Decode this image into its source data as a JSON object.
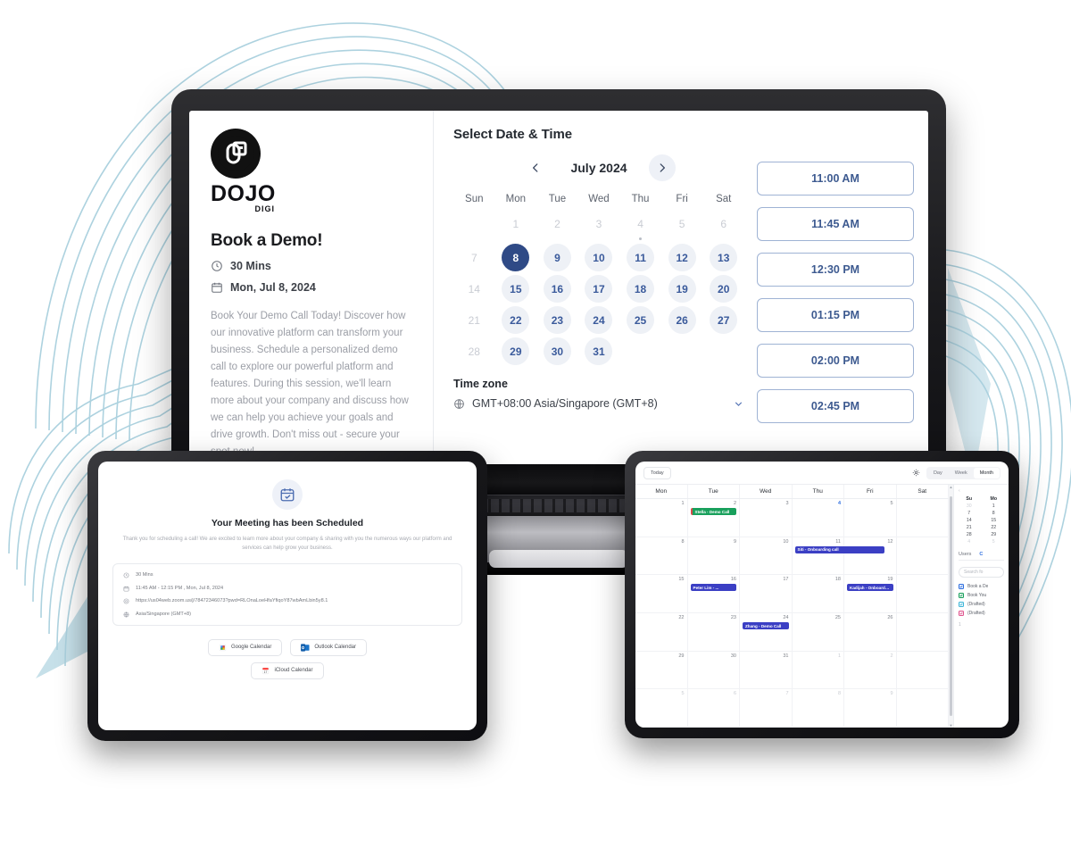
{
  "colors": {
    "swirl": "#a9d0de",
    "accent": "#2f4a86",
    "slot_border": "#9fb3d4",
    "slot_text": "#3d5a90",
    "event_blue": "#3b3fc4",
    "event_green": "#19a05c",
    "device_frame": "#17171a"
  },
  "booking_panel": {
    "logo_word": "DOJO",
    "logo_sub": "DIGI",
    "title": "Book a Demo!",
    "duration": "30 Mins",
    "date": "Mon, Jul 8, 2024",
    "description": "Book Your Demo Call Today!\nDiscover how our innovative platform can transform your business. Schedule a personalized demo call to explore our powerful platform and features. During this session, we'll learn more about your company and discuss how we can help you achieve your goals and drive growth.\nDon't miss out - secure your spot now!"
  },
  "select_panel": {
    "title": "Select Date & Time",
    "month_label": "July 2024",
    "prev_label": "‹",
    "next_label": "›",
    "dow": [
      "Sun",
      "Mon",
      "Tue",
      "Wed",
      "Thu",
      "Fri",
      "Sat"
    ],
    "weeks": [
      [
        {
          "n": "",
          "t": "blank"
        },
        {
          "n": "1",
          "t": "muted"
        },
        {
          "n": "2",
          "t": "muted"
        },
        {
          "n": "3",
          "t": "muted"
        },
        {
          "n": "4",
          "t": "muted",
          "dot": true
        },
        {
          "n": "5",
          "t": "muted"
        },
        {
          "n": "6",
          "t": "muted"
        }
      ],
      [
        {
          "n": "7",
          "t": "muted"
        },
        {
          "n": "8",
          "t": "sel"
        },
        {
          "n": "9",
          "t": "avail"
        },
        {
          "n": "10",
          "t": "avail"
        },
        {
          "n": "11",
          "t": "avail"
        },
        {
          "n": "12",
          "t": "avail"
        },
        {
          "n": "13",
          "t": "avail"
        }
      ],
      [
        {
          "n": "14",
          "t": "muted"
        },
        {
          "n": "15",
          "t": "avail"
        },
        {
          "n": "16",
          "t": "avail"
        },
        {
          "n": "17",
          "t": "avail"
        },
        {
          "n": "18",
          "t": "avail"
        },
        {
          "n": "19",
          "t": "avail"
        },
        {
          "n": "20",
          "t": "avail"
        }
      ],
      [
        {
          "n": "21",
          "t": "muted"
        },
        {
          "n": "22",
          "t": "avail"
        },
        {
          "n": "23",
          "t": "avail"
        },
        {
          "n": "24",
          "t": "avail"
        },
        {
          "n": "25",
          "t": "avail"
        },
        {
          "n": "26",
          "t": "avail"
        },
        {
          "n": "27",
          "t": "avail"
        }
      ],
      [
        {
          "n": "28",
          "t": "muted"
        },
        {
          "n": "29",
          "t": "avail"
        },
        {
          "n": "30",
          "t": "avail"
        },
        {
          "n": "31",
          "t": "avail"
        },
        {
          "n": "",
          "t": "blank"
        },
        {
          "n": "",
          "t": "blank"
        },
        {
          "n": "",
          "t": "blank"
        }
      ]
    ],
    "timezone_label": "Time zone",
    "timezone_value": "GMT+08:00 Asia/Singapore (GMT+8)",
    "time_slots": [
      "11:00 AM",
      "11:45 AM",
      "12:30 PM",
      "01:15 PM",
      "02:00 PM",
      "02:45 PM"
    ]
  },
  "confirmation": {
    "title": "Your Meeting has been Scheduled",
    "subtitle": "Thank you for scheduling a call! We are excited to learn more about your company & sharing with you the numerous ways our platform and services can help grow your business.",
    "details": [
      {
        "icon": "clock-icon",
        "text": "30 Mins"
      },
      {
        "icon": "calendar-icon",
        "text": "11:45 AM - 12:15 PM , Mon, Jul 8, 2024"
      },
      {
        "icon": "location-icon",
        "text": "https://us04web.zoom.us/j/78472346073?pwd=RLOnaLoeHfaYfiqoY87wbAmLbin5y8.1"
      },
      {
        "icon": "globe-icon",
        "text": "Asia/Singapore (GMT+8)"
      }
    ],
    "buttons": [
      {
        "label": "Google Calendar",
        "icon": "google-calendar-icon"
      },
      {
        "label": "Outlook Calendar",
        "icon": "outlook-calendar-icon"
      },
      {
        "label": "iCloud Calendar",
        "icon": "icloud-calendar-icon"
      }
    ]
  },
  "month_calendar": {
    "today_button": "Today",
    "views": [
      {
        "label": "Day",
        "active": false
      },
      {
        "label": "Week",
        "active": false
      },
      {
        "label": "Month",
        "active": true
      }
    ],
    "dow": [
      "Mon",
      "Tue",
      "Wed",
      "Thu",
      "Fri",
      "Sat"
    ],
    "weeks": [
      [
        {
          "n": "1"
        },
        {
          "n": "2",
          "event": {
            "label": "Stella - Demo Call",
            "color": "#19a05c",
            "bar": "#d84b4b"
          }
        },
        {
          "n": "3"
        },
        {
          "n": "4",
          "today": true
        },
        {
          "n": "5"
        },
        {
          "n": ""
        }
      ],
      [
        {
          "n": "8"
        },
        {
          "n": "9"
        },
        {
          "n": "10"
        },
        {
          "n": "11",
          "event": {
            "label": "Siti - Onboarding call",
            "color": "#3b3fc4",
            "wide": true
          }
        },
        {
          "n": "12"
        },
        {
          "n": ""
        }
      ],
      [
        {
          "n": "15"
        },
        {
          "n": "16",
          "event": {
            "label": "Peter Lim - ...",
            "color": "#3b3fc4"
          }
        },
        {
          "n": "17"
        },
        {
          "n": "18"
        },
        {
          "n": "19",
          "event": {
            "label": "Kadijah - Onboarding...",
            "color": "#3b3fc4"
          }
        },
        {
          "n": ""
        }
      ],
      [
        {
          "n": "22"
        },
        {
          "n": "23"
        },
        {
          "n": "24",
          "event": {
            "label": "Zhang - Demo Call",
            "color": "#3b3fc4"
          }
        },
        {
          "n": "25"
        },
        {
          "n": "26"
        },
        {
          "n": ""
        }
      ],
      [
        {
          "n": "29"
        },
        {
          "n": "30"
        },
        {
          "n": "31"
        },
        {
          "n": "1",
          "dim": true
        },
        {
          "n": "2",
          "dim": true
        },
        {
          "n": ""
        }
      ],
      [
        {
          "n": "5",
          "dim": true
        },
        {
          "n": "6",
          "dim": true
        },
        {
          "n": "7",
          "dim": true
        },
        {
          "n": "8",
          "dim": true
        },
        {
          "n": "9",
          "dim": true
        },
        {
          "n": "",
          "dim": true
        }
      ]
    ],
    "mini": {
      "head": [
        "Su",
        "Mo"
      ],
      "cells": [
        {
          "n": "30",
          "dim": true
        },
        {
          "n": "1"
        },
        {
          "n": "7"
        },
        {
          "n": "8"
        },
        {
          "n": "14"
        },
        {
          "n": "15"
        },
        {
          "n": "21"
        },
        {
          "n": "22"
        },
        {
          "n": "28"
        },
        {
          "n": "29"
        },
        {
          "n": "4",
          "dim": true
        },
        {
          "n": "5",
          "dim": true
        }
      ]
    },
    "side_tabs": [
      {
        "label": "Users",
        "active": false
      },
      {
        "label": "C",
        "active": true
      }
    ],
    "search_placeholder": "Search fo",
    "calendar_list": [
      {
        "label": "Book a De",
        "color": "#2f6fe0"
      },
      {
        "label": "Book You",
        "color": "#19a05c"
      },
      {
        "label": "(Drafted)",
        "color": "#3fb6d8"
      },
      {
        "label": "(Drafted)",
        "color": "#e0568f"
      }
    ],
    "page_num": "1"
  }
}
